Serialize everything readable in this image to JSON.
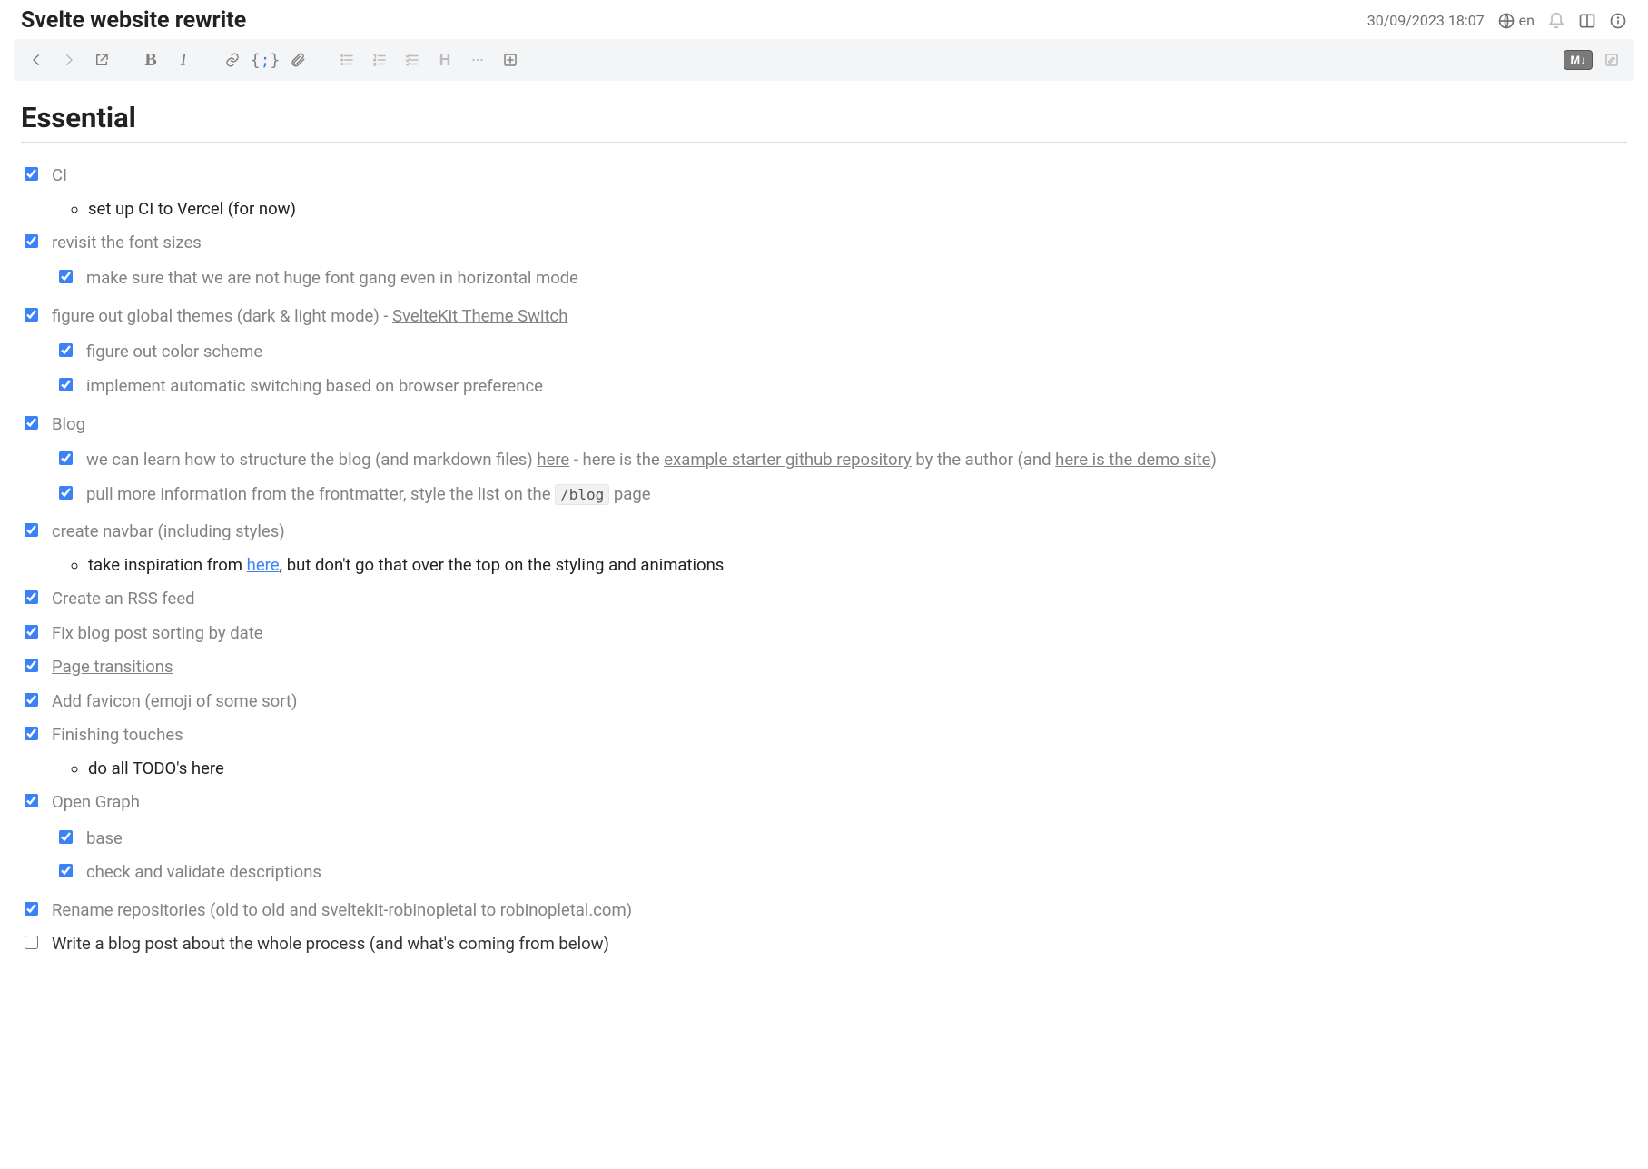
{
  "header": {
    "title": "Svelte website rewrite",
    "timestamp": "30/09/2023 18:07",
    "lang": "en"
  },
  "toolbar": {
    "md_label": "M↓"
  },
  "section": {
    "heading": "Essential"
  },
  "tasks": [
    {
      "checked": true,
      "fragments": [
        {
          "t": "CI"
        }
      ],
      "bullets": [
        {
          "fragments": [
            {
              "t": "set up CI to Vercel (for now)"
            }
          ]
        }
      ]
    },
    {
      "checked": true,
      "fragments": [
        {
          "t": "revisit the font sizes"
        }
      ],
      "subtasks": [
        {
          "checked": true,
          "fragments": [
            {
              "t": "make sure that we are not huge font gang even in horizontal mode"
            }
          ]
        }
      ]
    },
    {
      "checked": true,
      "fragments": [
        {
          "t": "figure out global themes (dark & light mode) - "
        },
        {
          "t": "SvelteKit Theme Switch",
          "link": true
        }
      ],
      "subtasks": [
        {
          "checked": true,
          "fragments": [
            {
              "t": "figure out color scheme"
            }
          ]
        },
        {
          "checked": true,
          "fragments": [
            {
              "t": "implement automatic switching based on browser preference"
            }
          ]
        }
      ]
    },
    {
      "checked": true,
      "fragments": [
        {
          "t": "Blog"
        }
      ],
      "subtasks": [
        {
          "checked": true,
          "fragments": [
            {
              "t": "we can learn how to structure the blog (and markdown files) "
            },
            {
              "t": "here",
              "link": true
            },
            {
              "t": " - here is the "
            },
            {
              "t": "example starter github repository",
              "link": true
            },
            {
              "t": " by the author (and "
            },
            {
              "t": "here is the demo site",
              "link": true
            },
            {
              "t": ")"
            }
          ]
        },
        {
          "checked": true,
          "fragments": [
            {
              "t": "pull more information from the frontmatter, style the list on the "
            },
            {
              "t": "/blog",
              "code": true
            },
            {
              "t": " page"
            }
          ]
        }
      ]
    },
    {
      "checked": true,
      "fragments": [
        {
          "t": "create navbar (including styles)"
        }
      ],
      "bullets": [
        {
          "fragments": [
            {
              "t": "take inspiration from "
            },
            {
              "t": "here",
              "link": true
            },
            {
              "t": ", but don't go that over the top on the styling and animations"
            }
          ]
        }
      ]
    },
    {
      "checked": true,
      "fragments": [
        {
          "t": "Create an RSS feed"
        }
      ]
    },
    {
      "checked": true,
      "fragments": [
        {
          "t": "Fix blog post sorting by date"
        }
      ]
    },
    {
      "checked": true,
      "fragments": [
        {
          "t": "Page transitions",
          "link": true
        }
      ]
    },
    {
      "checked": true,
      "fragments": [
        {
          "t": "Add favicon (emoji of some sort)"
        }
      ]
    },
    {
      "checked": true,
      "fragments": [
        {
          "t": "Finishing touches"
        }
      ],
      "bullets": [
        {
          "fragments": [
            {
              "t": "do all TODO's here"
            }
          ]
        }
      ]
    },
    {
      "checked": true,
      "fragments": [
        {
          "t": "Open Graph"
        }
      ],
      "subtasks": [
        {
          "checked": true,
          "fragments": [
            {
              "t": "base"
            }
          ]
        },
        {
          "checked": true,
          "fragments": [
            {
              "t": "check and validate descriptions"
            }
          ]
        }
      ]
    },
    {
      "checked": true,
      "fragments": [
        {
          "t": "Rename repositories (old to old and sveltekit-robinopletal to robinopletal.com)"
        }
      ]
    },
    {
      "checked": false,
      "fragments": [
        {
          "t": "Write a blog post about the whole process (and what's coming from below)"
        }
      ]
    }
  ]
}
